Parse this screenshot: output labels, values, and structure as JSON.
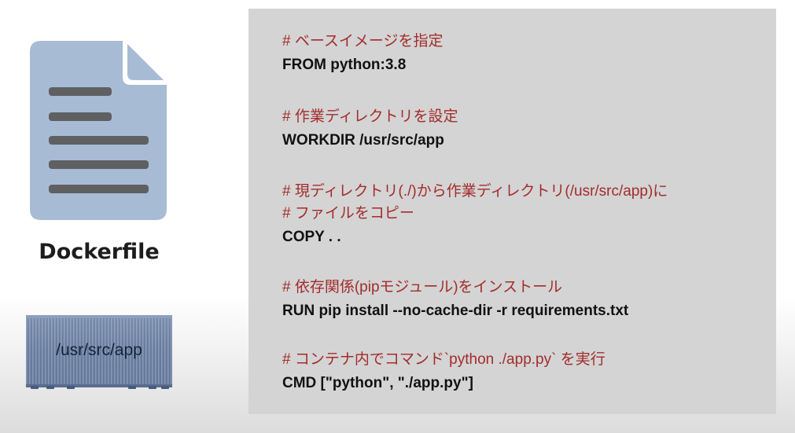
{
  "file": {
    "icon": "document-icon",
    "caption": "Dockerfile",
    "colors": {
      "body": "#a7bcd4",
      "lines": "#5f6062"
    }
  },
  "container": {
    "icon": "shipping-container-icon",
    "label": "/usr/src/app",
    "color": "#6e84a8"
  },
  "code": {
    "background": "#d4d4d4",
    "comment_color": "#a32c2c",
    "blocks": [
      {
        "comment": "# ベースイメージを指定",
        "command": "FROM python:3.8"
      },
      {
        "comment": "# 作業ディレクトリを設定",
        "command": "WORKDIR /usr/src/app"
      },
      {
        "comment": "# 現ディレクトリ(./)から作業ディレクトリ(/usr/src/app)に",
        "comment2": "# ファイルをコピー",
        "command": "COPY . ."
      },
      {
        "comment": "# 依存関係(pipモジュール)をインストール",
        "command": "RUN pip install --no-cache-dir -r requirements.txt"
      },
      {
        "comment": "# コンテナ内でコマンド`python ./app.py` を実行",
        "command": "CMD [\"python\", \"./app.py\"]"
      }
    ]
  }
}
